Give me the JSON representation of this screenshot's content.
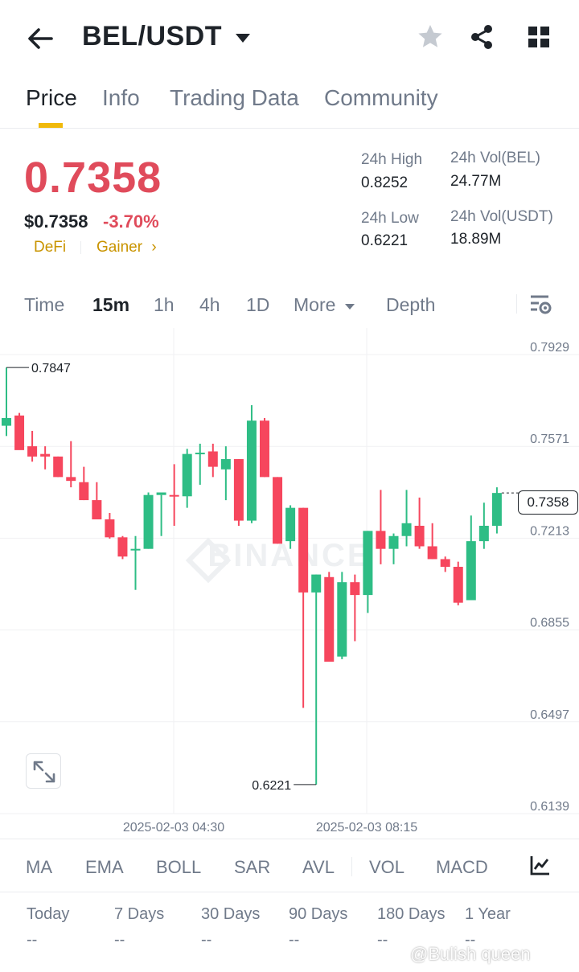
{
  "header": {
    "pair": "BEL/USDT",
    "icons": {
      "back": "arrow-left-icon",
      "caret": "caret-down-icon",
      "favorite": "star-icon",
      "share": "share-icon",
      "grid": "grid-icon"
    }
  },
  "tabs": [
    {
      "label": "Price",
      "active": true
    },
    {
      "label": "Info",
      "active": false
    },
    {
      "label": "Trading Data",
      "active": false
    },
    {
      "label": "Community",
      "active": false
    }
  ],
  "ticker": {
    "last_price": "0.7358",
    "usd_price": "$0.7358",
    "change_pct": "-3.70%",
    "tags": [
      "DeFi",
      "Gainer"
    ],
    "high_label": "24h High",
    "high_value": "0.8252",
    "low_label": "24h Low",
    "low_value": "0.6221",
    "vol_base_label": "24h Vol(BEL)",
    "vol_base_value": "24.77M",
    "vol_quote_label": "24h Vol(USDT)",
    "vol_quote_value": "18.89M"
  },
  "intervals": {
    "time": "Time",
    "items": [
      "15m",
      "1h",
      "4h",
      "1D"
    ],
    "active": "15m",
    "more": "More",
    "depth": "Depth"
  },
  "chart": {
    "watermark": "BINANCE",
    "price_tag": "0.7358",
    "max_label": "0.7847",
    "min_label": "0.6221",
    "y_ticks": [
      "0.7929",
      "0.7571",
      "0.7213",
      "0.6855",
      "0.6497",
      "0.6139"
    ],
    "x_ticks": [
      "2025-02-03 04:30",
      "2025-02-03 08:15"
    ],
    "colors": {
      "up": "#2ebd85",
      "down": "#f6465d"
    }
  },
  "chart_data": {
    "type": "candlestick",
    "interval": "15m",
    "ylim": [
      0.6139,
      0.7929
    ],
    "y_ticks": [
      0.7929,
      0.7571,
      0.7213,
      0.6855,
      0.6497,
      0.6139
    ],
    "x_ticks": [
      "2025-02-03 04:30",
      "2025-02-03 08:15"
    ],
    "last_price": 0.7358,
    "max_marked": 0.7847,
    "min_marked": 0.6221,
    "candles": [
      {
        "o": 0.762,
        "h": 0.7847,
        "l": 0.758,
        "c": 0.765
      },
      {
        "o": 0.766,
        "h": 0.767,
        "l": 0.754,
        "c": 0.7525
      },
      {
        "o": 0.754,
        "h": 0.76,
        "l": 0.748,
        "c": 0.75
      },
      {
        "o": 0.751,
        "h": 0.754,
        "l": 0.745,
        "c": 0.75
      },
      {
        "o": 0.75,
        "h": 0.75,
        "l": 0.742,
        "c": 0.742
      },
      {
        "o": 0.742,
        "h": 0.756,
        "l": 0.738,
        "c": 0.7405
      },
      {
        "o": 0.74,
        "h": 0.746,
        "l": 0.733,
        "c": 0.733
      },
      {
        "o": 0.733,
        "h": 0.74,
        "l": 0.726,
        "c": 0.7255
      },
      {
        "o": 0.7255,
        "h": 0.728,
        "l": 0.718,
        "c": 0.7185
      },
      {
        "o": 0.7185,
        "h": 0.719,
        "l": 0.71,
        "c": 0.711
      },
      {
        "o": 0.714,
        "h": 0.719,
        "l": 0.698,
        "c": 0.714
      },
      {
        "o": 0.714,
        "h": 0.736,
        "l": 0.714,
        "c": 0.735
      },
      {
        "o": 0.735,
        "h": 0.735,
        "l": 0.719,
        "c": 0.736
      },
      {
        "o": 0.735,
        "h": 0.747,
        "l": 0.723,
        "c": 0.7345
      },
      {
        "o": 0.7345,
        "h": 0.753,
        "l": 0.73,
        "c": 0.751
      },
      {
        "o": 0.751,
        "h": 0.755,
        "l": 0.739,
        "c": 0.7515
      },
      {
        "o": 0.752,
        "h": 0.755,
        "l": 0.742,
        "c": 0.746
      },
      {
        "o": 0.745,
        "h": 0.754,
        "l": 0.733,
        "c": 0.749
      },
      {
        "o": 0.749,
        "h": 0.749,
        "l": 0.723,
        "c": 0.725
      },
      {
        "o": 0.725,
        "h": 0.77,
        "l": 0.724,
        "c": 0.764
      },
      {
        "o": 0.764,
        "h": 0.765,
        "l": 0.742,
        "c": 0.742
      },
      {
        "o": 0.742,
        "h": 0.742,
        "l": 0.716,
        "c": 0.716
      },
      {
        "o": 0.717,
        "h": 0.731,
        "l": 0.714,
        "c": 0.73
      },
      {
        "o": 0.73,
        "h": 0.73,
        "l": 0.652,
        "c": 0.697
      },
      {
        "o": 0.697,
        "h": 0.704,
        "l": 0.6221,
        "c": 0.704
      },
      {
        "o": 0.703,
        "h": 0.705,
        "l": 0.67,
        "c": 0.67
      },
      {
        "o": 0.672,
        "h": 0.705,
        "l": 0.671,
        "c": 0.701
      },
      {
        "o": 0.701,
        "h": 0.704,
        "l": 0.678,
        "c": 0.696
      },
      {
        "o": 0.696,
        "h": 0.721,
        "l": 0.689,
        "c": 0.721
      },
      {
        "o": 0.721,
        "h": 0.737,
        "l": 0.708,
        "c": 0.714
      },
      {
        "o": 0.714,
        "h": 0.72,
        "l": 0.708,
        "c": 0.719
      },
      {
        "o": 0.719,
        "h": 0.737,
        "l": 0.715,
        "c": 0.724
      },
      {
        "o": 0.723,
        "h": 0.734,
        "l": 0.714,
        "c": 0.715
      },
      {
        "o": 0.715,
        "h": 0.724,
        "l": 0.71,
        "c": 0.71
      },
      {
        "o": 0.71,
        "h": 0.711,
        "l": 0.705,
        "c": 0.707
      },
      {
        "o": 0.707,
        "h": 0.709,
        "l": 0.692,
        "c": 0.693
      },
      {
        "o": 0.694,
        "h": 0.727,
        "l": 0.694,
        "c": 0.717
      },
      {
        "o": 0.717,
        "h": 0.732,
        "l": 0.714,
        "c": 0.723
      },
      {
        "o": 0.723,
        "h": 0.738,
        "l": 0.72,
        "c": 0.7358
      }
    ]
  },
  "indicators": [
    "MA",
    "EMA",
    "BOLL",
    "SAR",
    "AVL",
    "VOL",
    "MACD"
  ],
  "performance": [
    {
      "label": "Today",
      "value": "--"
    },
    {
      "label": "7 Days",
      "value": "--"
    },
    {
      "label": "30 Days",
      "value": "--"
    },
    {
      "label": "90 Days",
      "value": "--"
    },
    {
      "label": "180 Days",
      "value": "--"
    },
    {
      "label": "1 Year",
      "value": "--"
    }
  ],
  "watermark_overlay": "@Bulish queen"
}
